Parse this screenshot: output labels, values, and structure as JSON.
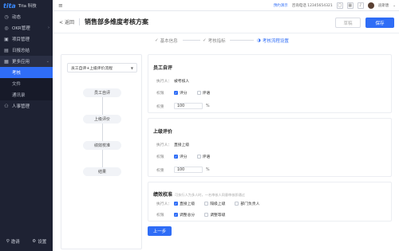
{
  "app": {
    "logo_mark": "tita",
    "logo_text": "Tita 科技"
  },
  "sidebar": {
    "items": [
      {
        "icon": "clock-icon",
        "label": "动态"
      },
      {
        "icon": "target-icon",
        "label": "OKR管理"
      },
      {
        "icon": "project-icon",
        "label": "项目管理"
      },
      {
        "icon": "report-icon",
        "label": "日报总结"
      },
      {
        "icon": "apps-icon",
        "label": "更多应用"
      }
    ],
    "sub_items": [
      {
        "label": "考核",
        "active": true
      },
      {
        "label": "文件",
        "active": false
      },
      {
        "label": "通讯录",
        "active": false
      }
    ],
    "extra_item": {
      "icon": "users-icon",
      "label": "人事管理"
    },
    "footer": {
      "invite": "邀请",
      "settings": "设置"
    }
  },
  "topbar": {
    "link": "预约演示",
    "phone": "咨询电话 12345654321",
    "user": "迪斯唐"
  },
  "header": {
    "back": "返回",
    "title": "销售部多维度考核方案",
    "draft_button": "草稿",
    "save_button": "保存"
  },
  "steps": [
    {
      "label": "基本信息",
      "state": "done"
    },
    {
      "label": "考核指标",
      "state": "done"
    },
    {
      "label": "考核流程设置",
      "state": "active"
    }
  ],
  "flow": {
    "select_value": "员工自评+上级评价流程",
    "nodes": [
      "员工自评",
      "上级评价",
      "绩效校准",
      "结果"
    ]
  },
  "sections": {
    "self": {
      "title": "员工自评",
      "executor_label": "执行人：",
      "executor_value": "被考核人",
      "perm_label": "权限",
      "perm_options": [
        {
          "label": "评分",
          "checked": true
        },
        {
          "label": "评语",
          "checked": false
        }
      ],
      "weight_label": "权重",
      "weight_value": "100",
      "weight_unit": "%"
    },
    "superior": {
      "title": "上级评价",
      "executor_label": "执行人：",
      "executor_value": "直接上级",
      "perm_label": "权限",
      "perm_options": [
        {
          "label": "评分",
          "checked": true
        },
        {
          "label": "评语",
          "checked": false
        }
      ],
      "weight_label": "权重",
      "weight_value": "100",
      "weight_unit": "%"
    },
    "calibration": {
      "title": "绩效校准",
      "note": "可执行人为多人时，一名审核人同意审核即通过",
      "executor_label": "执行人：",
      "executor_options": [
        {
          "label": "直接上级",
          "checked": true
        },
        {
          "label": "隔级上级",
          "checked": false
        },
        {
          "label": "部门负责人",
          "checked": false
        }
      ],
      "perm_label": "权限",
      "perm_options": [
        {
          "label": "调整总分",
          "checked": true
        },
        {
          "label": "调整等级",
          "checked": false
        }
      ]
    }
  },
  "footer": {
    "prev_button": "上一步"
  },
  "colors": {
    "accent": "#2f6df6",
    "sidebar_bg": "#1e2233"
  }
}
